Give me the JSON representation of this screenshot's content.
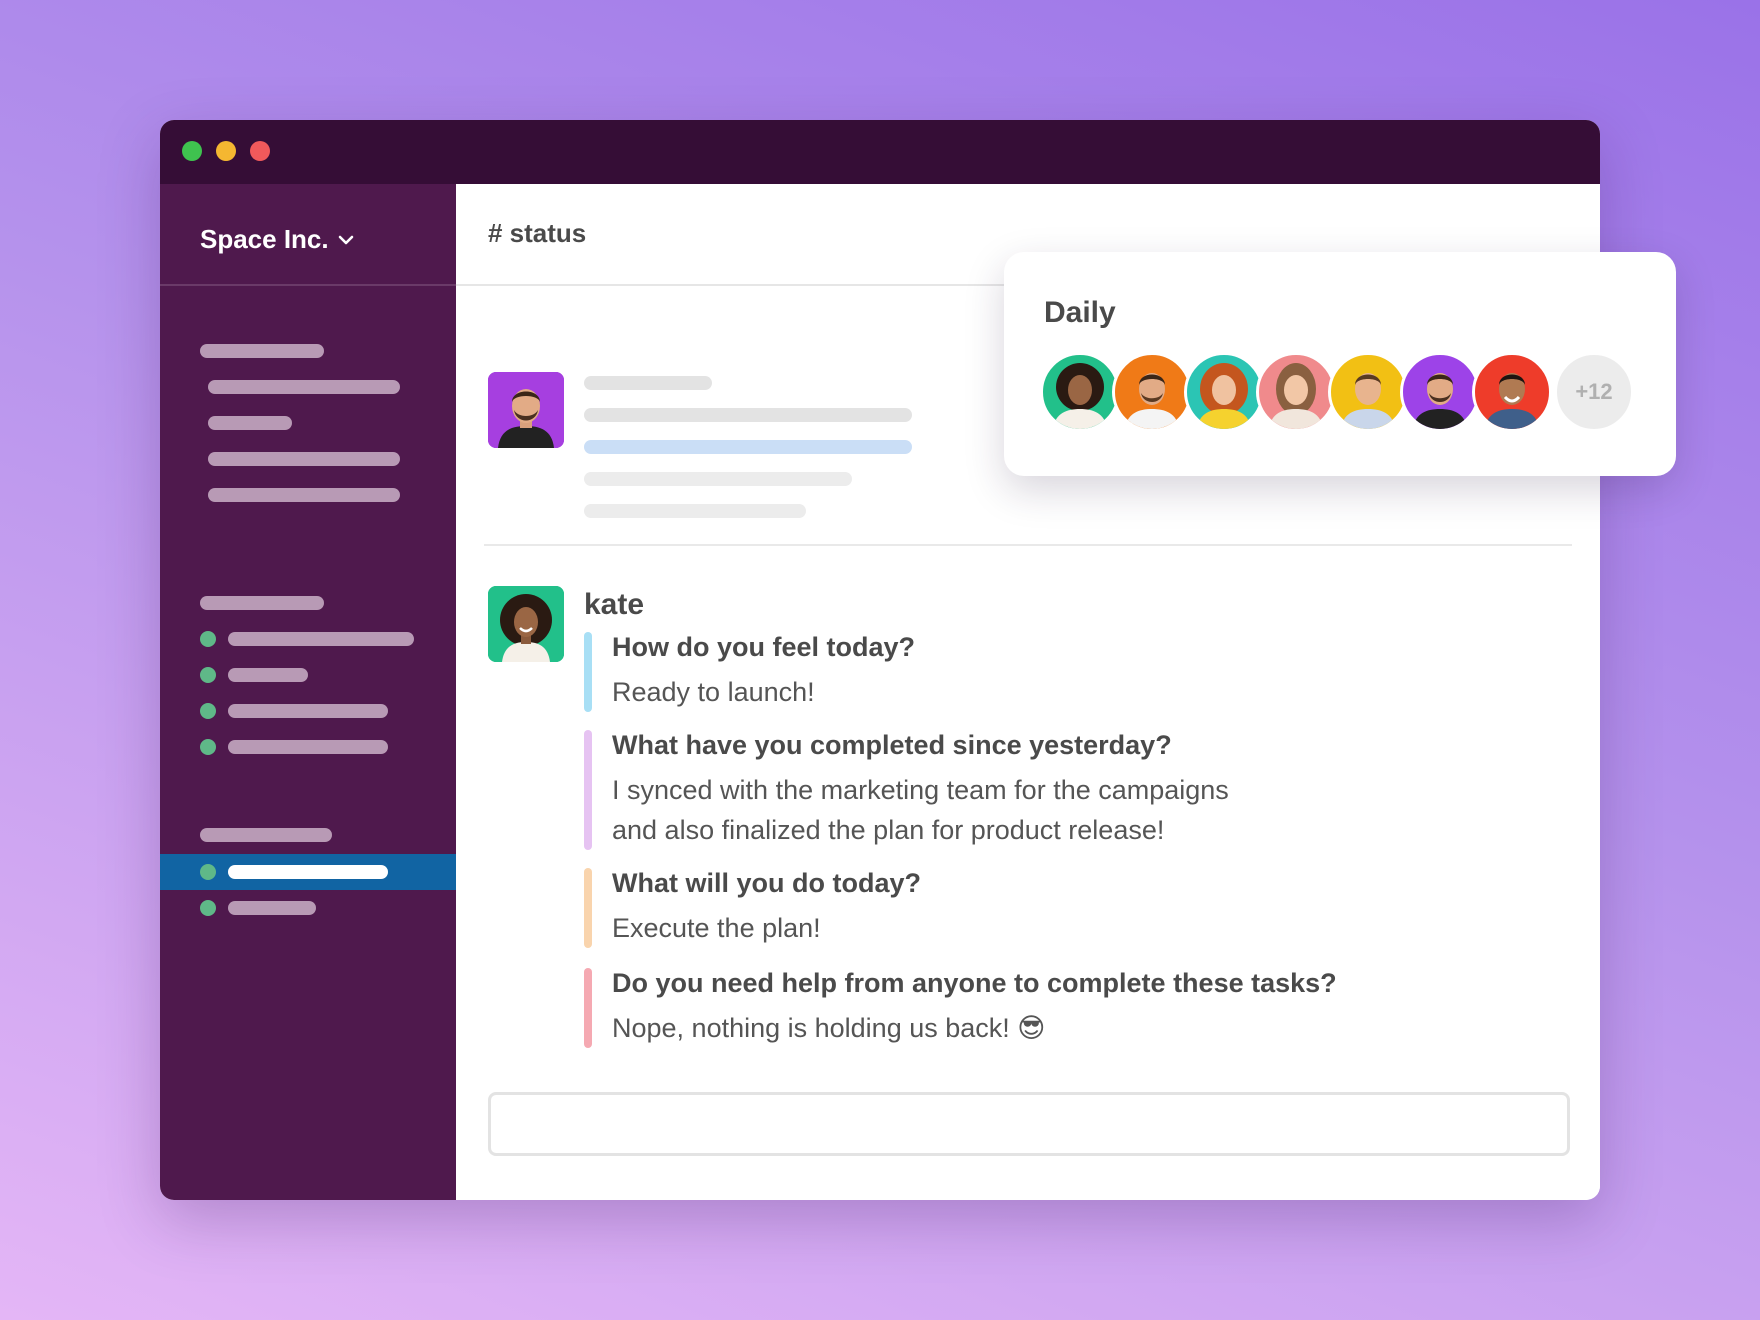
{
  "window": {
    "controls": [
      "close",
      "minimize",
      "zoom"
    ]
  },
  "sidebar": {
    "workspace_name": "Space Inc."
  },
  "channel": {
    "name": "# status"
  },
  "message": {
    "username": "kate",
    "standup": [
      {
        "question": "How do you feel today?",
        "answer": [
          "Ready to launch!"
        ],
        "accent": "#a8dff5"
      },
      {
        "question": "What have you completed since yesterday?",
        "answer": [
          "I synced with the marketing team for the campaigns",
          "and also finalized the plan for product release!"
        ],
        "accent": "#e6c3f2"
      },
      {
        "question": "What will you do today?",
        "answer": [
          "Execute the plan!"
        ],
        "accent": "#f9d4ad"
      },
      {
        "question": "Do you need help from anyone to complete these tasks?",
        "answer": [
          "Nope, nothing is holding us back! 😎"
        ],
        "accent": "#f5a9b2"
      }
    ]
  },
  "popup": {
    "title": "Daily",
    "more_count": "+12",
    "avatar_colors": [
      "#22c08a",
      "#f07a17",
      "#2bc5b4",
      "#f08a8c",
      "#f2c014",
      "#9d43e8",
      "#ee3c2a"
    ]
  },
  "colors": {
    "sidebar": "#4f194d",
    "titlebar": "#350d36",
    "active": "#1164a3",
    "online": "#5fb888"
  }
}
